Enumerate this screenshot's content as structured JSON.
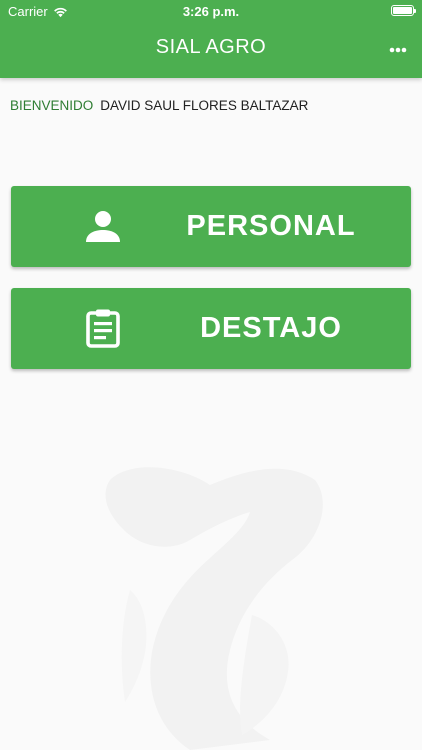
{
  "status_bar": {
    "carrier": "Carrier",
    "time": "3:26 p.m."
  },
  "app_bar": {
    "title": "SIAL AGRO",
    "menu_icon": "more-horizontal-icon"
  },
  "welcome": {
    "label": "BIENVENIDO",
    "user_name": "DAVID SAUL FLORES BALTAZAR"
  },
  "menu": [
    {
      "label": "PERSONAL",
      "icon": "person-icon"
    },
    {
      "label": "DESTAJO",
      "icon": "clipboard-icon"
    }
  ],
  "colors": {
    "primary": "#4caf50",
    "accent_text": "#2e7d32",
    "background": "#fafafa"
  }
}
